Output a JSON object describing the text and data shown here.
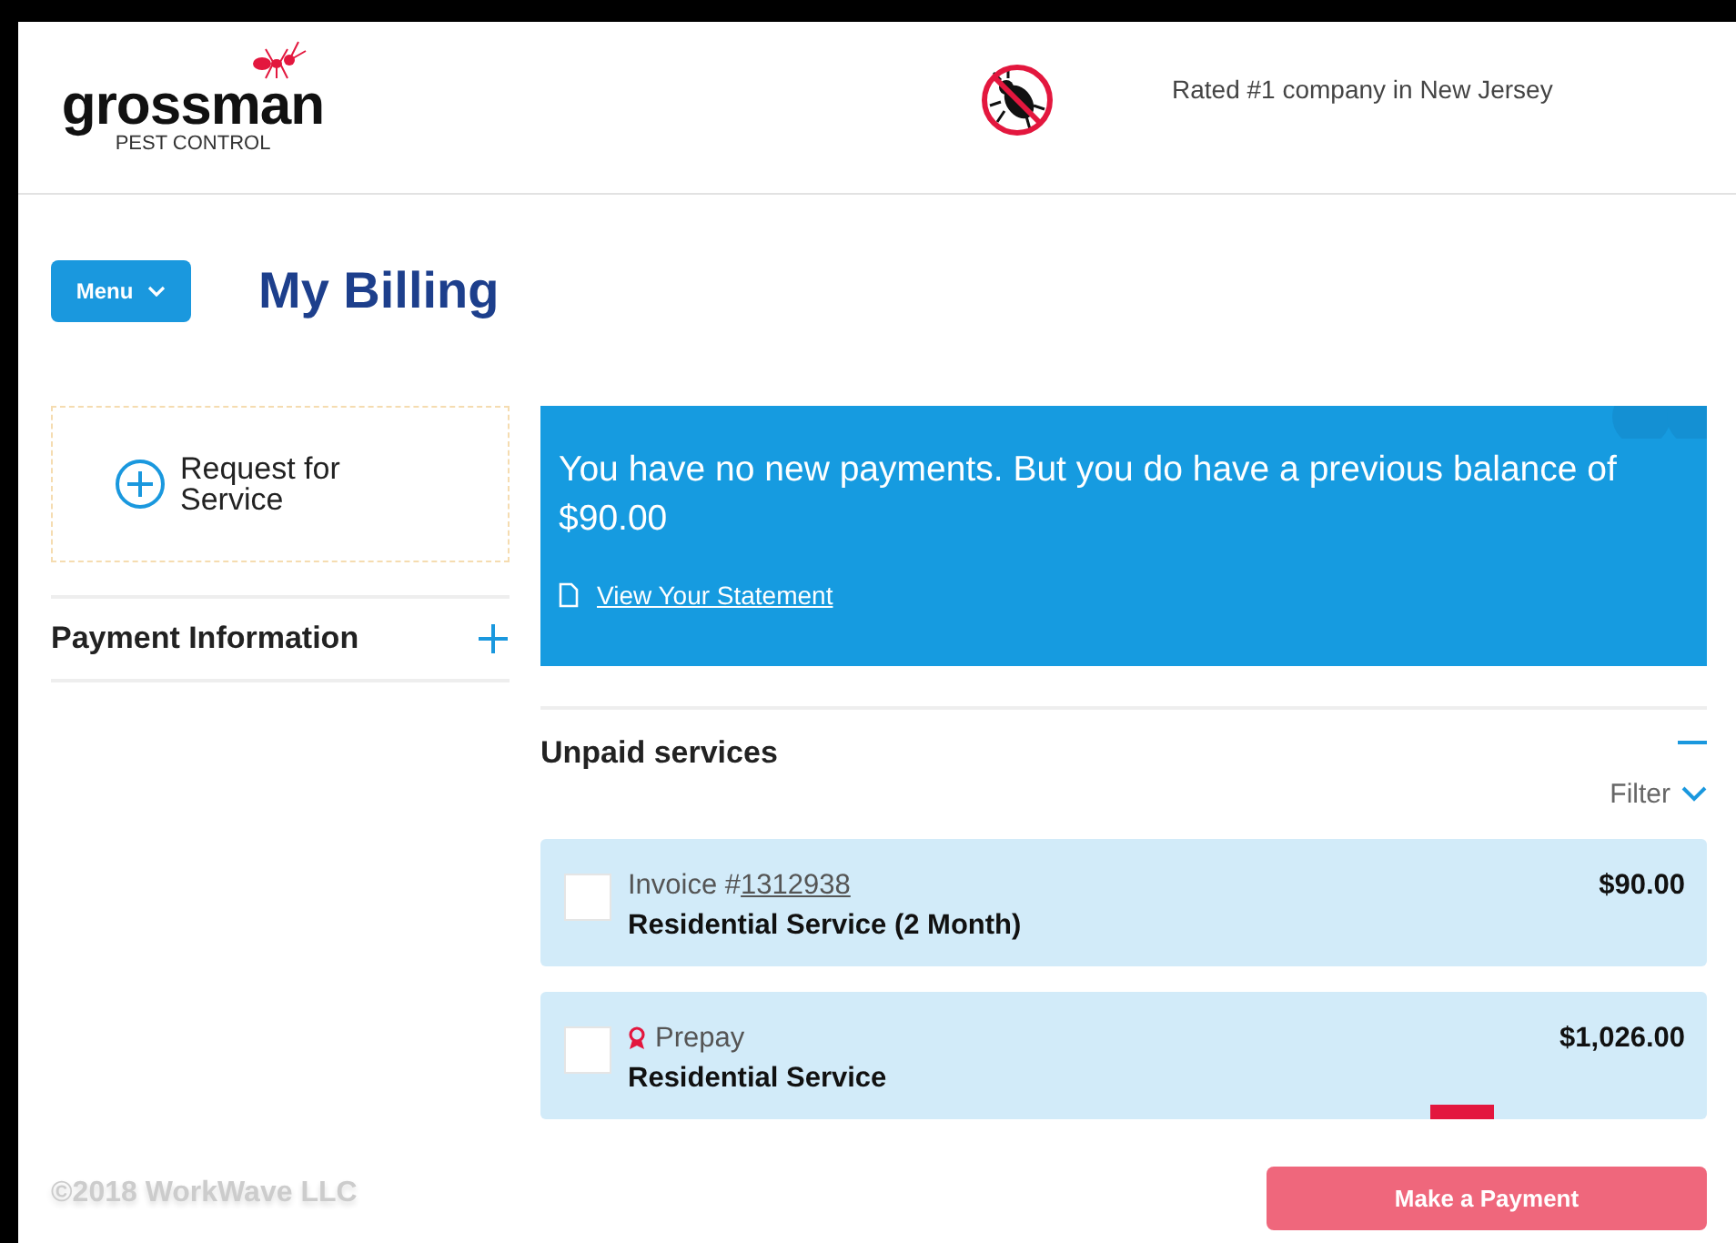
{
  "header": {
    "logo": {
      "name": "grossman",
      "tagline": "PEST CONTROL"
    },
    "slogan": "Rated #1 company in New Jersey"
  },
  "menu_button": {
    "label": "Menu"
  },
  "page_title": "My Billing",
  "sidebar": {
    "request_button": "Request for Service",
    "sections": [
      {
        "title": "Payment Information",
        "expanded": false
      }
    ]
  },
  "banner": {
    "message": "You have no new payments. But you do have a previous balance of $90.00",
    "link": "View Your Statement"
  },
  "unpaid": {
    "title": "Unpaid services",
    "expanded": true,
    "filter": "Filter",
    "items": [
      {
        "kind": "invoice",
        "label": "Invoice #",
        "number": "1312938",
        "service": "Residential Service (2 Month)",
        "amount": "$90.00",
        "checked": false
      },
      {
        "kind": "prepay",
        "label": "Prepay",
        "service": "Residential Service",
        "amount": "$1,026.00",
        "checked": false
      }
    ]
  },
  "pay_button": "Make a Payment",
  "footer": "©2018 WorkWave LLC"
}
